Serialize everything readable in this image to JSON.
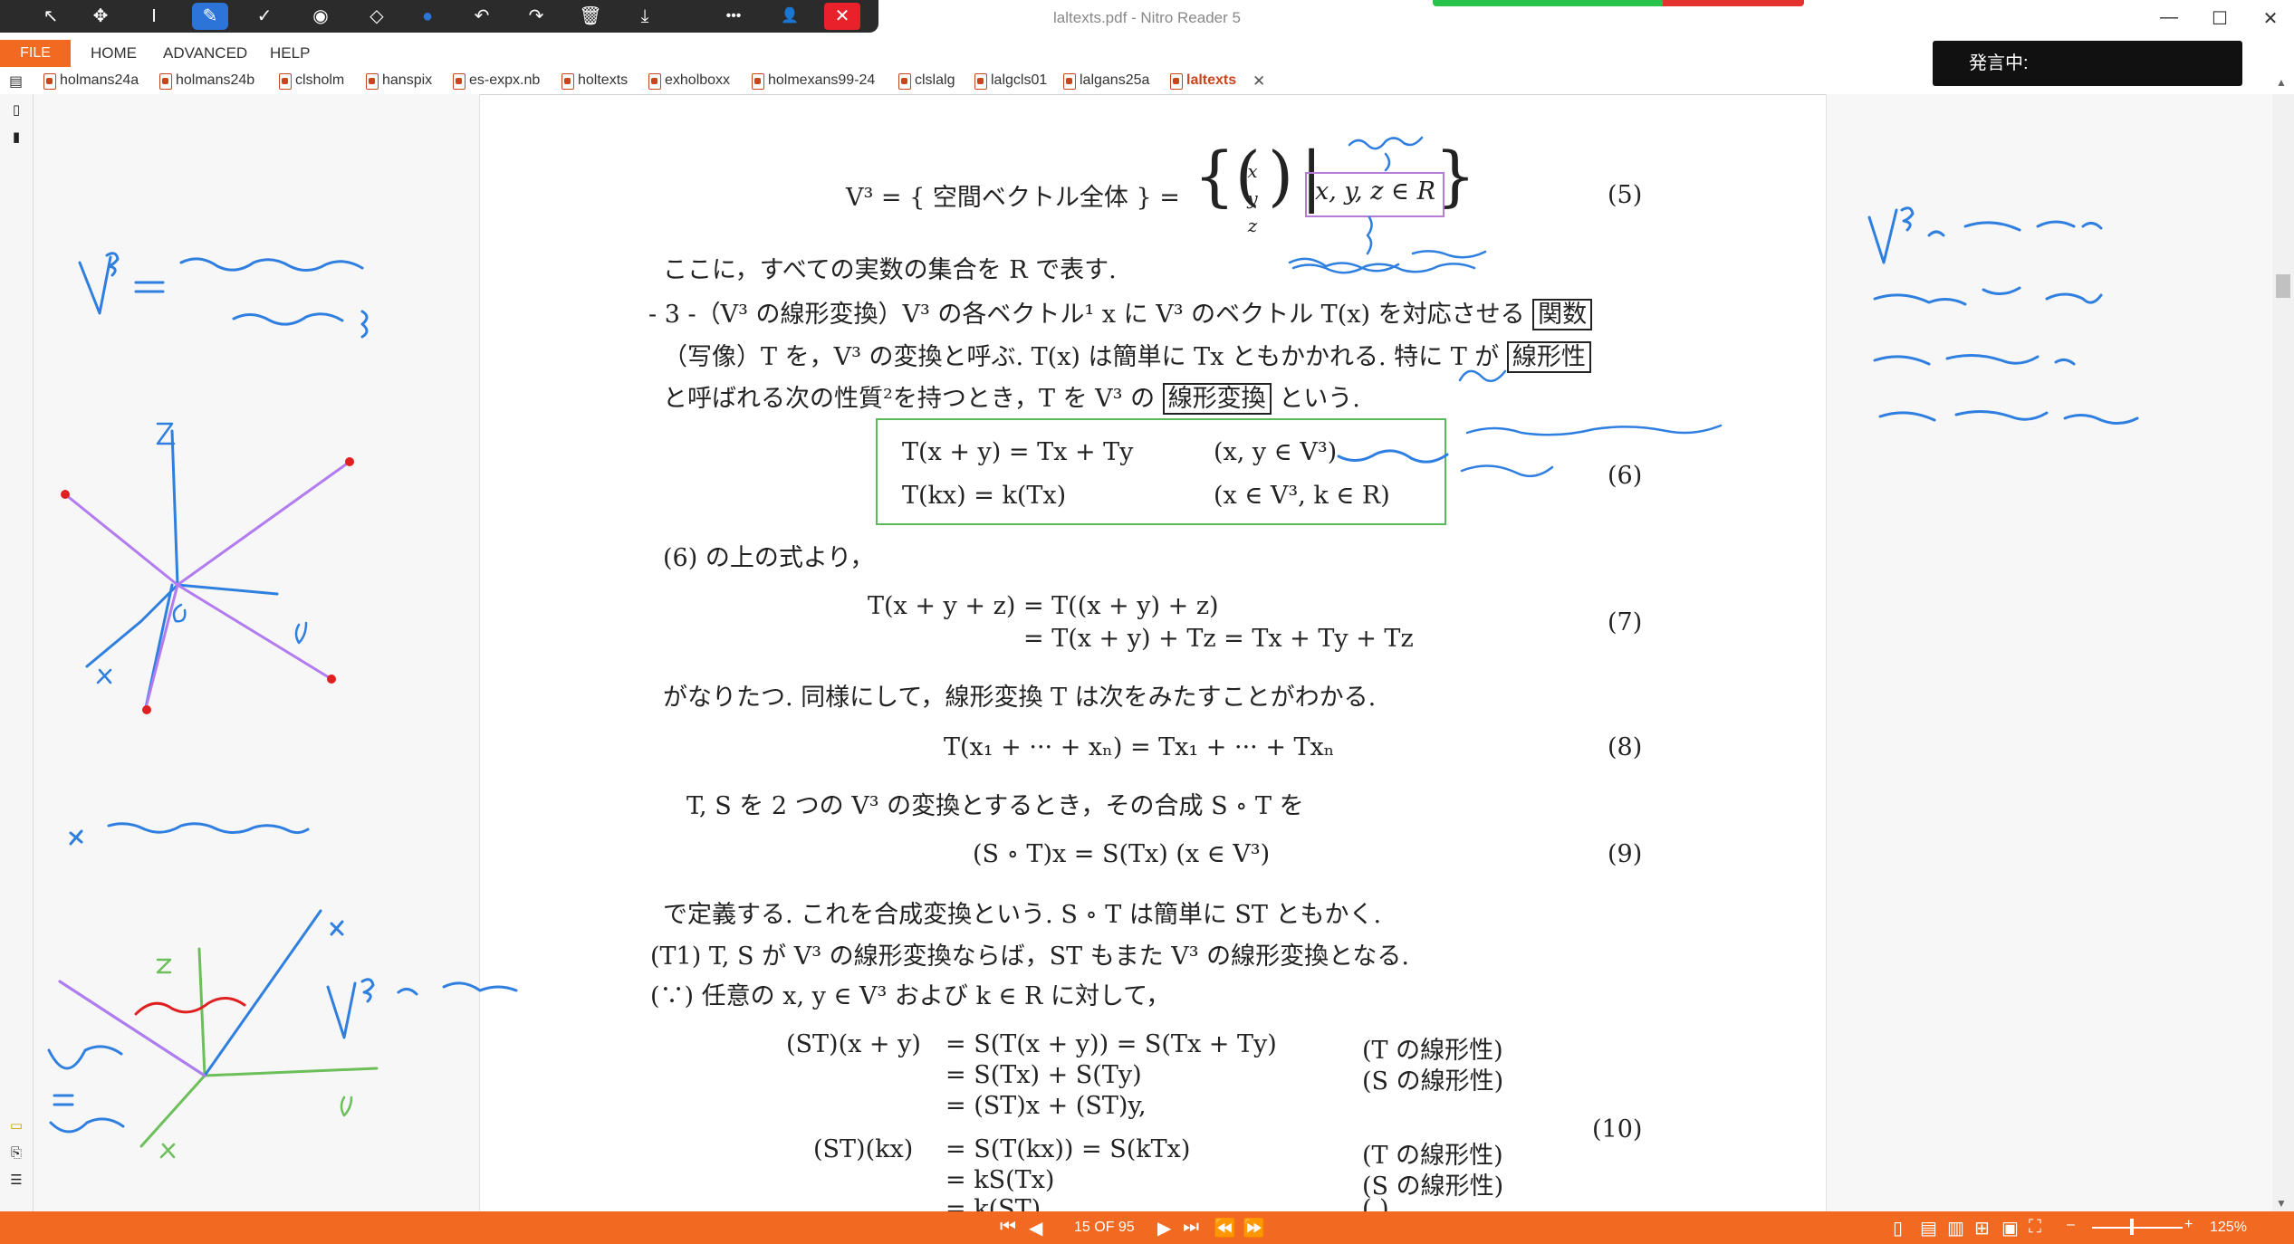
{
  "window": {
    "title": "laltexts.pdf - Nitro Reader 5",
    "controls": [
      "—",
      "☐",
      "✕"
    ]
  },
  "pen_toolbar": {
    "tools": [
      {
        "name": "select-arrow-icon",
        "glyph": "↖"
      },
      {
        "name": "move-icon",
        "glyph": "✥"
      },
      {
        "name": "text-cursor-icon",
        "glyph": "I"
      },
      {
        "name": "pen-icon",
        "glyph": "✎"
      },
      {
        "name": "check-icon",
        "glyph": "✓"
      },
      {
        "name": "stamp-icon",
        "glyph": "◉"
      },
      {
        "name": "eraser-icon",
        "glyph": "◇"
      },
      {
        "name": "color-icon",
        "glyph": "●"
      },
      {
        "name": "undo-icon",
        "glyph": "↶"
      },
      {
        "name": "redo-icon",
        "glyph": "↷"
      },
      {
        "name": "trash-icon",
        "glyph": "🗑"
      },
      {
        "name": "download-icon",
        "glyph": "⤓"
      },
      {
        "name": "more-icon",
        "glyph": "•••"
      },
      {
        "name": "person-icon",
        "glyph": "👤"
      },
      {
        "name": "close-icon",
        "glyph": "✕"
      }
    ],
    "pen_color": "#1e6fe0",
    "accent": "#2d74d9"
  },
  "menu": {
    "file": "FILE",
    "items": [
      "HOME",
      "ADVANCED",
      "HELP"
    ],
    "speaking_label": "発言中:"
  },
  "doc_tabs": [
    "holmans24a",
    "holmans24b",
    "clsholm",
    "hanspix",
    "es-expx.nb",
    "holtexts",
    "exholboxx",
    "holmexans99-24",
    "clslalg",
    "lalgcls01",
    "lalgans25a",
    "laltexts"
  ],
  "active_tab": "laltexts",
  "document": {
    "eq5_left": "V³ = { 空間ベクトル全体 } = ",
    "eq5_vec": [
      "x",
      "y",
      "z"
    ],
    "eq5_cond": "x, y, z ∈ R",
    "eq5_no": "(5)",
    "line1": "ここに，すべての実数の集合を R で表す.",
    "line2_a": "- 3 -（V³ の線形変換）V³ の各ベクトル¹ x に V³ のベクトル T(x) を対応させる",
    "line2_box": "関数",
    "line3_a": "（写像）T を，V³ の変換と呼ぶ. T(x) は簡単に Tx ともかかれる. 特に T が",
    "line3_box": "線形性",
    "line4_a": "と呼ばれる次の性質²を持つとき，T を V³ の",
    "line4_box": "線形変換",
    "line4_b": "という.",
    "eq6_l1": "T(x + y) = Tx + Ty",
    "eq6_l1_cond": "(x, y ∈ V³)",
    "eq6_l2": "T(kx) = k(Tx)",
    "eq6_l2_cond": "(x ∈ V³, k ∈ R)",
    "eq6_no": "(6)",
    "line5": "(6) の上の式より，",
    "eq7_l1": "T(x + y + z) =  T((x + y) + z)",
    "eq7_l2": "=  T(x + y) + Tz = Tx + Ty + Tz",
    "eq7_no": "(7)",
    "line6": "がなりたつ. 同様にして，線形変換 T は次をみたすことがわかる.",
    "eq8": "T(x₁ + ··· + xₙ) = Tx₁ + ··· + Txₙ",
    "eq8_no": "(8)",
    "line7": "T, S を 2 つの V³ の変換とするとき，その合成 S ∘ T を",
    "eq9": "(S ∘ T)x = S(Tx)        (x ∈ V³)",
    "eq9_no": "(9)",
    "line8": "で定義する. これを合成変換という. S ∘ T は簡単に ST ともかく.",
    "line9": "(T1)  T, S が V³ の線形変換ならば，ST もまた V³ の線形変換となる.",
    "line10": "(∵) 任意の x, y ∈ V³ および k ∈ R に対して，",
    "eq10_rows": [
      {
        "lhs": "(ST)(x + y)",
        "rhs": "= S(T(x + y)) = S(Tx + Ty)",
        "note": "(T の線形性)"
      },
      {
        "lhs": "",
        "rhs": "= S(Tx) + S(Ty)",
        "note": "(S の線形性)"
      },
      {
        "lhs": "",
        "rhs": "= (ST)x + (ST)y,",
        "note": ""
      },
      {
        "lhs": "(ST)(kx)",
        "rhs": "= S(T(kx)) = S(kTx)",
        "note": "(T の線形性)"
      },
      {
        "lhs": "",
        "rhs": "= kS(Tx)",
        "note": "(S の線形性)"
      },
      {
        "lhs": "",
        "rhs": "= k(ST)",
        "note": "(          )"
      }
    ],
    "eq10_no": "(10)"
  },
  "status": {
    "page_indicator": "15 OF 95",
    "zoom": "125%"
  }
}
